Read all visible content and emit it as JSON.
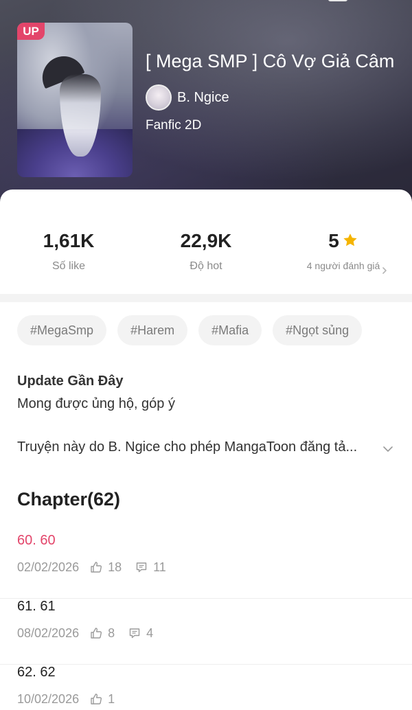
{
  "book": {
    "badge": "UP",
    "title": "[ Mega SMP ] Cô Vợ Giả Câm",
    "author": "B. Ngice",
    "genre": "Fanfic 2D"
  },
  "stats": {
    "likes_value": "1,61K",
    "likes_label": "Số like",
    "hot_value": "22,9K",
    "hot_label": "Độ hot",
    "rating_value": "5",
    "rating_label": "4 người đánh giá"
  },
  "tags": [
    "#MegaSmp",
    "#Harem",
    "#Mafia",
    "#Ngọt sủng"
  ],
  "update": {
    "title": "Update Gần Đây",
    "text": "Mong được ủng hộ, góp ý"
  },
  "license_text": "Truyện này do B. Ngice cho phép MangaToon đăng tả...",
  "chapters_title": "Chapter(62)",
  "chapters": [
    {
      "name": "60. 60",
      "date": "02/02/2026",
      "likes": "18",
      "comments": "11",
      "current": true
    },
    {
      "name": "61. 61",
      "date": "08/02/2026",
      "likes": "8",
      "comments": "4",
      "current": false
    },
    {
      "name": "62. 62",
      "date": "10/02/2026",
      "likes": "1",
      "comments": "",
      "current": false
    }
  ],
  "colors": {
    "accent": "#e3456a",
    "star": "#f5b400",
    "muted": "#8a8a8a"
  },
  "icons": {
    "rating": "star-icon",
    "rating_more": "chevron-right-icon",
    "expand": "chevron-down-icon",
    "likes": "thumbs-up-icon",
    "comments": "comment-icon"
  }
}
